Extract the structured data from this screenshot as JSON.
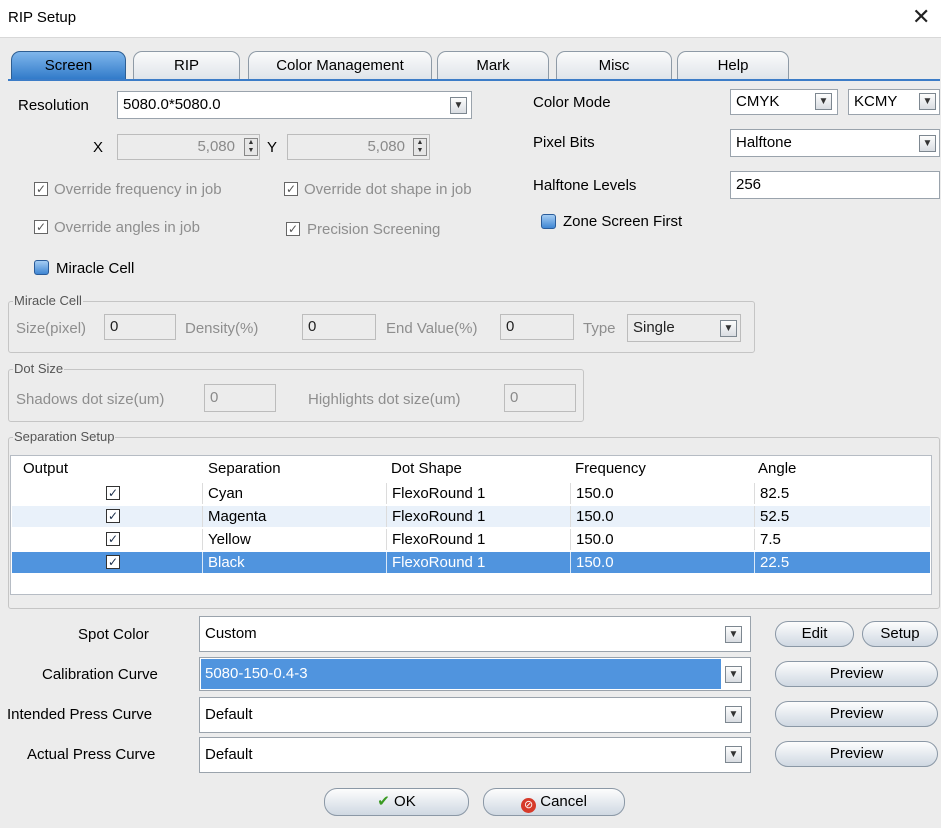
{
  "window": {
    "title": "RIP Setup",
    "close_glyph": "✕"
  },
  "tabs": [
    "Screen",
    "RIP",
    "Color Management",
    "Mark",
    "Misc",
    "Help"
  ],
  "resolution": {
    "label": "Resolution",
    "value": "5080.0*5080.0",
    "x_label": "X",
    "x_value": "5,080",
    "y_label": "Y",
    "y_value": "5,080"
  },
  "checks": {
    "override_frequency": "Override frequency in job",
    "override_dot_shape": "Override dot shape in job",
    "override_angles": "Override angles in job",
    "precision_screening": "Precision Screening",
    "miracle_cell": "Miracle Cell",
    "zone_screen_first": "Zone Screen First"
  },
  "color_mode": {
    "label": "Color Mode",
    "value1": "CMYK",
    "value2": "KCMY"
  },
  "pixel_bits": {
    "label": "Pixel Bits",
    "value": "Halftone"
  },
  "halftone_levels": {
    "label": "Halftone Levels",
    "value": "256"
  },
  "miracle_group": {
    "title": "Miracle Cell",
    "size_label": "Size(pixel)",
    "size_value": "0",
    "density_label": "Density(%)",
    "density_value": "0",
    "end_label": "End Value(%)",
    "end_value": "0",
    "type_label": "Type",
    "type_value": "Single"
  },
  "dot_size_group": {
    "title": "Dot Size",
    "shadows_label": "Shadows dot size(um)",
    "shadows_value": "0",
    "highlights_label": "Highlights dot size(um)",
    "highlights_value": "0"
  },
  "separation": {
    "title": "Separation Setup",
    "columns": [
      "Output",
      "Separation",
      "Dot Shape",
      "Frequency",
      "Angle"
    ],
    "rows": [
      {
        "name": "Cyan",
        "shape": "FlexoRound 1",
        "freq": "150.0",
        "angle": "82.5"
      },
      {
        "name": "Magenta",
        "shape": "FlexoRound 1",
        "freq": "150.0",
        "angle": "52.5"
      },
      {
        "name": "Yellow",
        "shape": "FlexoRound 1",
        "freq": "150.0",
        "angle": "7.5"
      },
      {
        "name": "Black",
        "shape": "FlexoRound 1",
        "freq": "150.0",
        "angle": "22.5"
      }
    ]
  },
  "curves": {
    "spot_label": "Spot Color",
    "spot_value": "Custom",
    "edit_label": "Edit",
    "setup_label": "Setup",
    "calib_label": "Calibration Curve",
    "calib_value": "5080-150-0.4-3",
    "intended_label": "Intended Press Curve",
    "intended_value": "Default",
    "actual_label": "Actual Press Curve",
    "actual_value": "Default",
    "preview_label": "Preview"
  },
  "buttons": {
    "ok": "OK",
    "cancel": "Cancel"
  },
  "colors": {
    "accent": "#2f79c8",
    "selection": "#5094de"
  }
}
